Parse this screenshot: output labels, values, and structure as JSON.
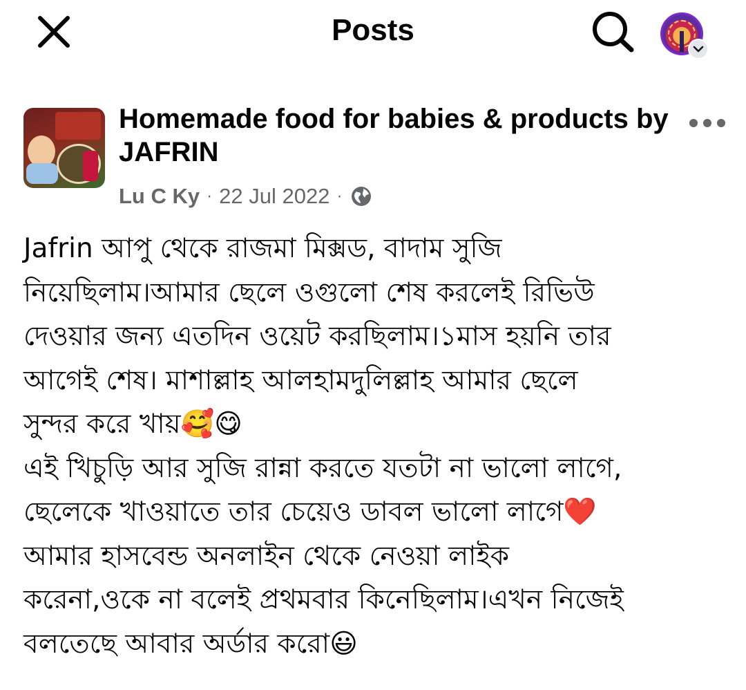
{
  "topbar": {
    "title": "Posts",
    "close_icon": "close-icon",
    "search_icon": "search-icon",
    "profile_chevron_icon": "chevron-down-icon"
  },
  "post": {
    "group_name": "Homemade food for babies & products by JAFRIN",
    "author": "Lu C Ky",
    "date": "22 Jul 2022",
    "separator": "·",
    "privacy_icon": "globe-icon",
    "lines": [
      "Jafrin আপু থেকে রাজমা মিক্সড, বাদাম সুজি",
      "নিয়েছিলাম।আমার ছেলে ওগুলো শেষ করলেই রিভিউ",
      "দেওয়ার জন্য এতদিন ওয়েট করছিলাম।১মাস হয়নি তার",
      "আগেই শেষ। মাশাল্লাহ আলহামদুলিল্লাহ আমার ছেলে",
      "সুন্দর করে খায়🥰😋",
      "এই খিচুড়ি আর সুজি রান্না করতে যতটা না ভালো লাগে,",
      "ছেলেকে খাওয়াতে তার চেয়েও ডাবল ভালো লাগে❤️",
      "আমার হাসবেন্ড অনলাইন থেকে নেওয়া লাইক",
      "করেনা,ওকে না বলেই প্রথমবার কিনেছিলাম।এখন নিজেই",
      "বলতেছে আবার অর্ডার করো😃"
    ]
  },
  "colors": {
    "text_primary": "#050505",
    "text_secondary": "#65676b",
    "background": "#ffffff"
  }
}
